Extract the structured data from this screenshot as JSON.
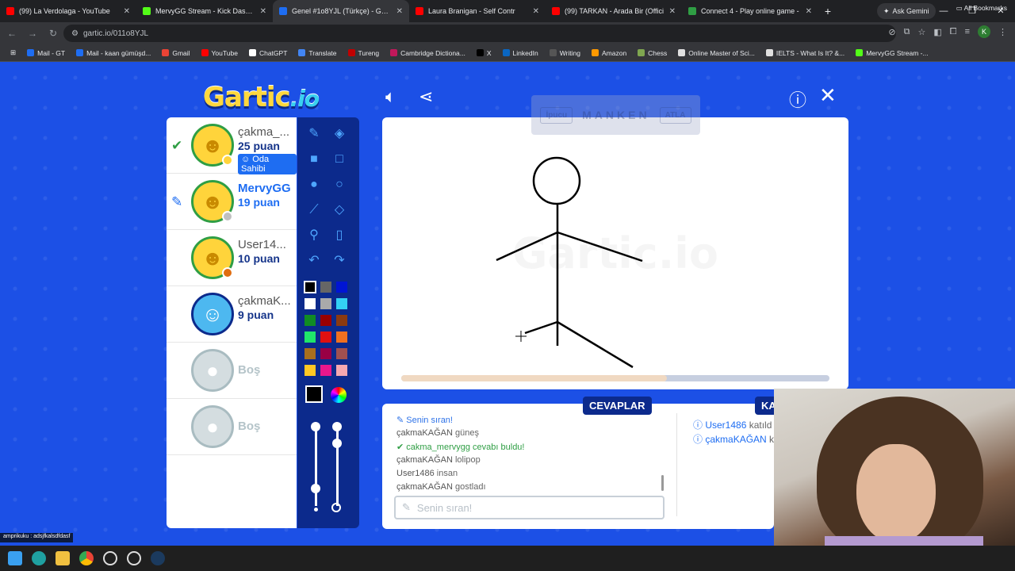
{
  "browser": {
    "tabs": [
      {
        "title": "(99) La Verdolaga - YouTube",
        "color": "#ff0000",
        "active": false
      },
      {
        "title": "MervyGG Stream - Kick Dashbo",
        "color": "#53fc18",
        "active": false
      },
      {
        "title": "Genel #1o8YJL (Türkçe) - Gartic",
        "color": "#1e6df2",
        "active": true
      },
      {
        "title": "Laura Branigan - Self Contr",
        "color": "#ff0000",
        "active": false
      },
      {
        "title": "(99) TARKAN - Arada Bir (Offici",
        "color": "#ff0000",
        "active": false
      },
      {
        "title": "Connect 4 - Play online game -",
        "color": "#2f9e44",
        "active": false
      }
    ],
    "ask_gemini": "Ask Gemini",
    "url": "gartic.io/011o8YJL",
    "bookmarks": [
      {
        "label": "Mail - GT",
        "color": "#1e6df2"
      },
      {
        "label": "Mail - kaan gümüşd...",
        "color": "#1e6df2"
      },
      {
        "label": "Gmail",
        "color": "#ea4335"
      },
      {
        "label": "YouTube",
        "color": "#ff0000"
      },
      {
        "label": "ChatGPT",
        "color": "#ffffff"
      },
      {
        "label": "Translate",
        "color": "#4285f4"
      },
      {
        "label": "Tureng",
        "color": "#c00000"
      },
      {
        "label": "Cambridge Dictiona...",
        "color": "#c2185b"
      },
      {
        "label": "X",
        "color": "#000000"
      },
      {
        "label": "LinkedIn",
        "color": "#0a66c2"
      },
      {
        "label": "Writing",
        "color": "#555555"
      },
      {
        "label": "Amazon",
        "color": "#ff9900"
      },
      {
        "label": "Chess",
        "color": "#7fa650"
      },
      {
        "label": "Online Master of Sci...",
        "color": "#e0e0e0"
      },
      {
        "label": "IELTS - What Is It? &...",
        "color": "#e0e0e0"
      },
      {
        "label": "MervyGG Stream -...",
        "color": "#53fc18"
      }
    ],
    "all_bookmarks": "All Bookmarks"
  },
  "game": {
    "logo_main": "Gartic",
    "logo_io": ".io",
    "word_hint": {
      "left": "İpucu",
      "word": "MANKEN",
      "right": "ATLA"
    },
    "players": [
      {
        "name": "çakma_...",
        "score": "25 puan",
        "badge_color": "#ffd43b",
        "owner": "Oda Sahibi",
        "mark": "check"
      },
      {
        "name": "MervyGG",
        "score": "19 puan",
        "badge_color": "#c0c0c0",
        "mark": "pencil"
      },
      {
        "name": "User14...",
        "score": "10 puan",
        "badge_color": "#e06d10"
      },
      {
        "name": "çakmaK...",
        "score": "9 puan"
      }
    ],
    "empty_slots": [
      "Boş",
      "Boş"
    ],
    "colors": [
      "#000000",
      "#666666",
      "#0015d4",
      "#ffffff",
      "#aaaaaa",
      "#33d1f5",
      "#118c24",
      "#990000",
      "#8b3a10",
      "#20e66a",
      "#e01010",
      "#f07020",
      "#a86f1e",
      "#990044",
      "#a05050",
      "#ffc824",
      "#e8178c",
      "#f5a8b0"
    ],
    "current_color": "#000000",
    "progress": 0.62,
    "tabs": {
      "answers": "CEVAPLAR",
      "chat": "KA"
    },
    "messages": [
      {
        "type": "turn",
        "text": "Senin sıran!"
      },
      {
        "type": "guess",
        "user": "çakmaKAĞAN",
        "text": "güneş"
      },
      {
        "type": "correct",
        "user": "cakma_mervygg",
        "text": "cevabı buldu!"
      },
      {
        "type": "guess",
        "user": "çakmaKAĞAN",
        "text": "lolipop"
      },
      {
        "type": "guess",
        "user": "User1486",
        "text": "insan"
      },
      {
        "type": "guess",
        "user": "çakmaKAĞAN",
        "text": "gostladı"
      }
    ],
    "input_placeholder": "Senin sıran!",
    "system_msgs": [
      {
        "user": "User1486",
        "text": "katıld"
      },
      {
        "user": "çakmaKAĞAN",
        "text": "k"
      }
    ]
  },
  "status_strip": "amprikuku : adsjfkalsdfdasf"
}
